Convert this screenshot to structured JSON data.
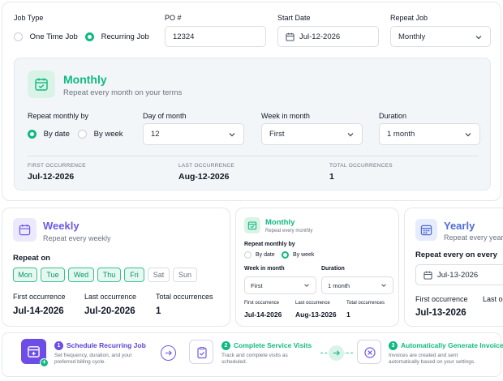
{
  "form": {
    "job_type": {
      "label": "Job Type",
      "options": [
        "One Time Job",
        "Recurring Job"
      ],
      "selected": "Recurring Job"
    },
    "po": {
      "label": "PO #",
      "value": "12324"
    },
    "start_date": {
      "label": "Start Date",
      "value": "Jul-12-2026"
    },
    "repeat_job": {
      "label": "Repeat Job",
      "value": "Monthly"
    }
  },
  "monthly_panel": {
    "title": "Monthly",
    "subtitle": "Repeat every month on your terms",
    "repeat_by": {
      "label": "Repeat monthly by",
      "options": [
        "By date",
        "By week"
      ],
      "selected": "By date"
    },
    "day_of_month": {
      "label": "Day of month",
      "value": "12"
    },
    "week_in_month": {
      "label": "Week in month",
      "value": "First"
    },
    "duration": {
      "label": "Duration",
      "value": "1 month"
    },
    "summary": [
      {
        "label": "FIRST OCCURRENCE",
        "value": "Jul-12-2026"
      },
      {
        "label": "LAST OCCURRENCE",
        "value": "Aug-12-2026"
      },
      {
        "label": "TOTAL OCCURRENCES",
        "value": "1"
      }
    ]
  },
  "weekly_card": {
    "title": "Weekly",
    "subtitle": "Repeat every weekly",
    "repeat_on_label": "Repeat on",
    "days": [
      {
        "label": "Mon",
        "selected": true
      },
      {
        "label": "Tue",
        "selected": true
      },
      {
        "label": "Wed",
        "selected": true
      },
      {
        "label": "Thu",
        "selected": true
      },
      {
        "label": "Fri",
        "selected": true
      },
      {
        "label": "Sat",
        "selected": false
      },
      {
        "label": "Sun",
        "selected": false
      }
    ],
    "summary": [
      {
        "label": "First occurrence",
        "value": "Jul-14-2026"
      },
      {
        "label": "Last occurrence",
        "value": "Jul-20-2026"
      },
      {
        "label": "Total occurrences",
        "value": "1"
      }
    ]
  },
  "monthly_card": {
    "title": "Monthly",
    "subtitle": "Repeat every monthly",
    "repeat_by_label": "Repeat monthly by",
    "options": [
      "By date",
      "By week"
    ],
    "selected": "By week",
    "week_in_month": {
      "label": "Week in month",
      "value": "First"
    },
    "duration": {
      "label": "Duration",
      "value": "1 month"
    },
    "summary": [
      {
        "label": "First occurrence",
        "value": "Jul-14-2026"
      },
      {
        "label": "Last occurrence",
        "value": "Aug-13-2026"
      },
      {
        "label": "Total occurrences",
        "value": "1"
      }
    ]
  },
  "yearly_card": {
    "title": "Yearly",
    "subtitle": "Repeat every yearly",
    "repeat_on_label": "Repeat every on every",
    "date_value": "Jul-13-2026",
    "summary": [
      {
        "label": "First occurrence",
        "value": "Jul-13-2026"
      },
      {
        "label": "Last oc",
        "value": ""
      }
    ]
  },
  "steps": [
    {
      "num": "1",
      "title": "Schedule Recurring Job",
      "desc1": "Set frequency, duration, and your",
      "desc2": "preferred billing cycle."
    },
    {
      "num": "2",
      "title": "Complete Service Visits",
      "desc1": "Track and complete visits as",
      "desc2": "scheduled."
    },
    {
      "num": "3",
      "title": "Automatically Generate Invoice",
      "desc1": "Invoices are created and sent",
      "desc2": "automatically based on your settings."
    }
  ],
  "colors": {
    "green": "#10b981",
    "purple": "#6d5ae6",
    "blue": "#4f6bd8"
  }
}
